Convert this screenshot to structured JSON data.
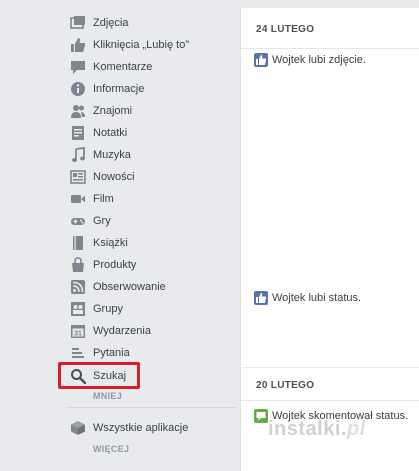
{
  "sidebar": {
    "items": [
      {
        "label": "Zdjęcia",
        "icon": "photo-icon"
      },
      {
        "label": "Kliknięcia „Lubię to”",
        "icon": "like-icon"
      },
      {
        "label": "Komentarze",
        "icon": "comment-icon"
      },
      {
        "label": "Informacje",
        "icon": "info-icon"
      },
      {
        "label": "Znajomi",
        "icon": "friends-icon"
      },
      {
        "label": "Notatki",
        "icon": "notes-icon"
      },
      {
        "label": "Muzyka",
        "icon": "music-icon"
      },
      {
        "label": "Nowości",
        "icon": "news-icon"
      },
      {
        "label": "Film",
        "icon": "video-icon"
      },
      {
        "label": "Gry",
        "icon": "games-icon"
      },
      {
        "label": "Książki",
        "icon": "books-icon"
      },
      {
        "label": "Produkty",
        "icon": "products-icon"
      },
      {
        "label": "Obserwowanie",
        "icon": "rss-icon"
      },
      {
        "label": "Grupy",
        "icon": "groups-icon"
      },
      {
        "label": "Wydarzenia",
        "icon": "calendar-icon"
      },
      {
        "label": "Pytania",
        "icon": "questions-icon"
      },
      {
        "label": "Szukaj",
        "icon": "search-icon"
      }
    ],
    "less_label": "MNIEJ",
    "all_apps_label": "Wszystkie aplikacje",
    "more_label": "WIĘCEJ"
  },
  "timeline": {
    "cards": [
      {
        "date": "24 LUTEGO",
        "stories": [
          "Wojtek lubi zdjęcie.",
          "Wojtek lubi status."
        ]
      },
      {
        "date": "20 LUTEGO",
        "stories": [
          "Wojtek skomentował status."
        ]
      }
    ]
  },
  "watermark": {
    "main": "instalki",
    "suffix": "pl"
  },
  "colors": {
    "highlight": "#d71f27",
    "like_blue": "#5b74a8",
    "comment_green": "#6aa84f"
  }
}
